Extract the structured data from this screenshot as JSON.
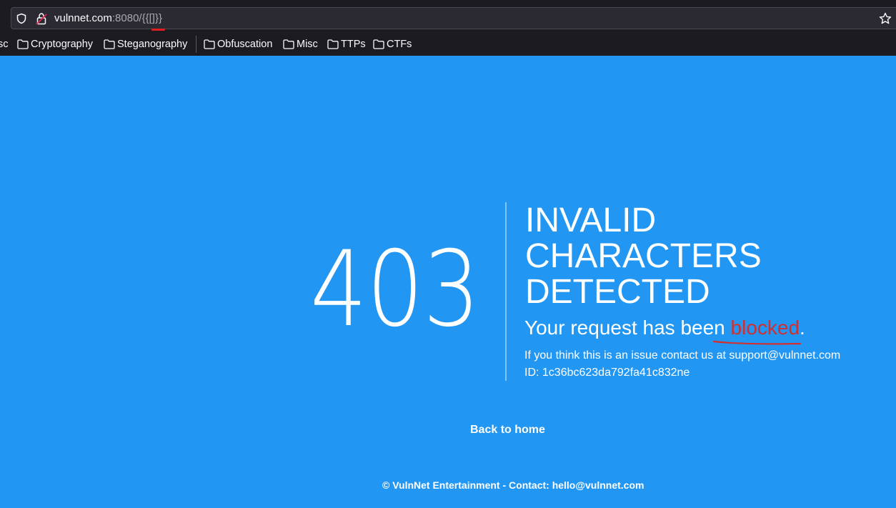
{
  "browser": {
    "url_host": "vulnnet.com",
    "url_port": ":8080",
    "url_path": "/{{[]}}",
    "bookmarks": [
      {
        "label": "sc"
      },
      {
        "label": "Cryptography"
      },
      {
        "label": "Steganography"
      },
      {
        "label": "Obfuscation"
      },
      {
        "label": "Misc"
      },
      {
        "label": "TTPs"
      },
      {
        "label": "CTFs"
      }
    ]
  },
  "error": {
    "code": "403",
    "headline_lines": [
      "INVALID",
      "CHARACTERS",
      "DETECTED"
    ],
    "subline_prefix": "Your request has been ",
    "subline_highlight": "blocked",
    "subline_suffix": ".",
    "info": "If you think this is an issue contact us at support@vulnnet.com",
    "id_line": "ID: 1c36bc623da792fa41c832ne",
    "back_link": "Back to home"
  },
  "footer": {
    "text": "© VulnNet Entertainment - Contact: hello@vulnnet.com"
  },
  "colors": {
    "page_background": "#2196f3",
    "chrome_background": "#1c1b22",
    "highlight_red": "#d32f2f"
  }
}
